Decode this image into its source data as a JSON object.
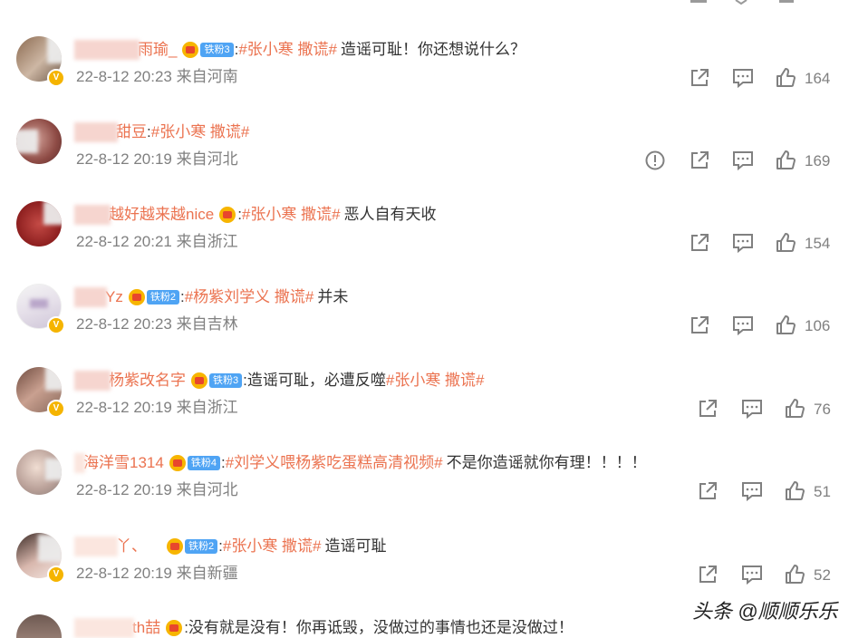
{
  "comments": [
    {
      "name_visible": "雨瑜_",
      "fan_badge": "铁粉3",
      "topic": "#张小寒 撒谎#",
      "text": "造谣可耻！你还想说什么？",
      "time": "22-8-12 20:23",
      "location": "来自河南",
      "likes": "164"
    },
    {
      "name_visible": "甜豆",
      "fan_badge": "",
      "topic": "#张小寒 撒谎#",
      "text": "",
      "time": "22-8-12 20:19",
      "location": "来自河北",
      "likes": "169"
    },
    {
      "name_visible": "越好越来越nice",
      "fan_badge": "",
      "topic": "#张小寒 撒谎#",
      "text": "恶人自有天收",
      "time": "22-8-12 20:21",
      "location": "来自浙江",
      "likes": "154"
    },
    {
      "name_visible": "Yz",
      "fan_badge": "铁粉2",
      "topic": "#杨紫刘学义 撒谎#",
      "text": "并未",
      "time": "22-8-12 20:23",
      "location": "来自吉林",
      "likes": "106"
    },
    {
      "name_visible": "杨紫改名字",
      "fan_badge": "铁粉3",
      "topic": "#张小寒 撒谎#",
      "text": "造谣可耻，必遭反噬",
      "time": "22-8-12 20:19",
      "location": "来自浙江",
      "likes": "76"
    },
    {
      "name_visible": "海洋雪1314",
      "fan_badge": "铁粉4",
      "topic": "#刘学义喂杨紫吃蛋糕高清视频#",
      "text": "不是你造谣就你有理！！！！",
      "time": "22-8-12 20:19",
      "location": "来自河北",
      "likes": "51"
    },
    {
      "name_visible": "丫、",
      "fan_badge": "铁粉2",
      "topic": "#张小寒 撒谎#",
      "text": "造谣可耻",
      "time": "22-8-12 20:19",
      "location": "来自新疆",
      "likes": "52"
    },
    {
      "name_visible": "th喆",
      "fan_badge": "",
      "topic": "",
      "text": "没有就是没有！你再诋毁，没做过的事情也还是没做过！",
      "time": "",
      "location": "",
      "likes": ""
    }
  ],
  "watermark": "头条 @顺顺乐乐",
  "colors": {
    "accent": "#eb7350",
    "meta": "#808080",
    "fan_badge": "#4fa4f4"
  },
  "icons": [
    "share-icon",
    "comment-icon",
    "like-icon",
    "report-icon",
    "crown-icon",
    "verified-badge-icon"
  ]
}
